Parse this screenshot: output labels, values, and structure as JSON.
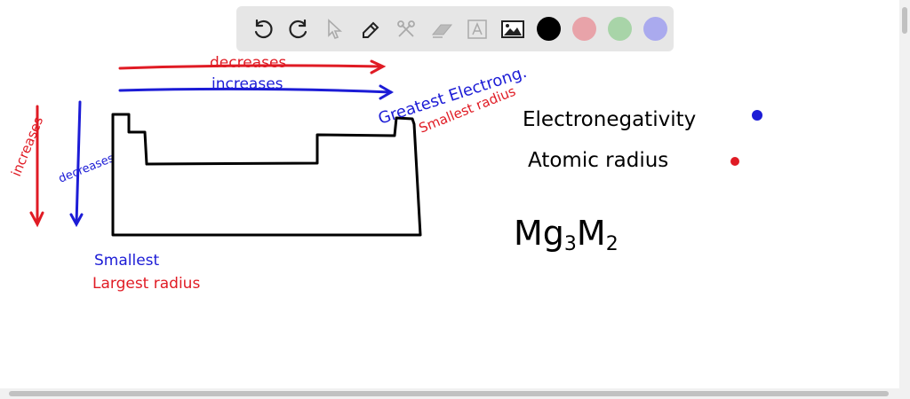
{
  "toolbar": {
    "tools": [
      "undo-icon",
      "redo-icon",
      "select-icon",
      "pen-icon",
      "tools-icon",
      "eraser-icon",
      "text-icon",
      "image-icon"
    ],
    "colors": [
      "#000000",
      "#e8a3a9",
      "#a8d4a8",
      "#aaaaee"
    ]
  },
  "drawing": {
    "ink_red": "#e01b24",
    "ink_blue": "#1c1cd6",
    "ink_black": "#000000",
    "top_red_label": "decreases",
    "top_blue_label": "increases",
    "left_red_label": "increases",
    "left_blue_label": "decreases",
    "top_right_blue": "Greatest Electrong.",
    "top_right_red": "Smallest radius",
    "bottom_left_blue": "Smallest",
    "bottom_left_red": "Largest radius",
    "legend_electronegativity": "Electronegativity",
    "legend_atomic_radius": "Atomic radius",
    "formula_main1": "Mg",
    "formula_sub1": "3",
    "formula_main2": "M",
    "formula_sub2": "2"
  }
}
